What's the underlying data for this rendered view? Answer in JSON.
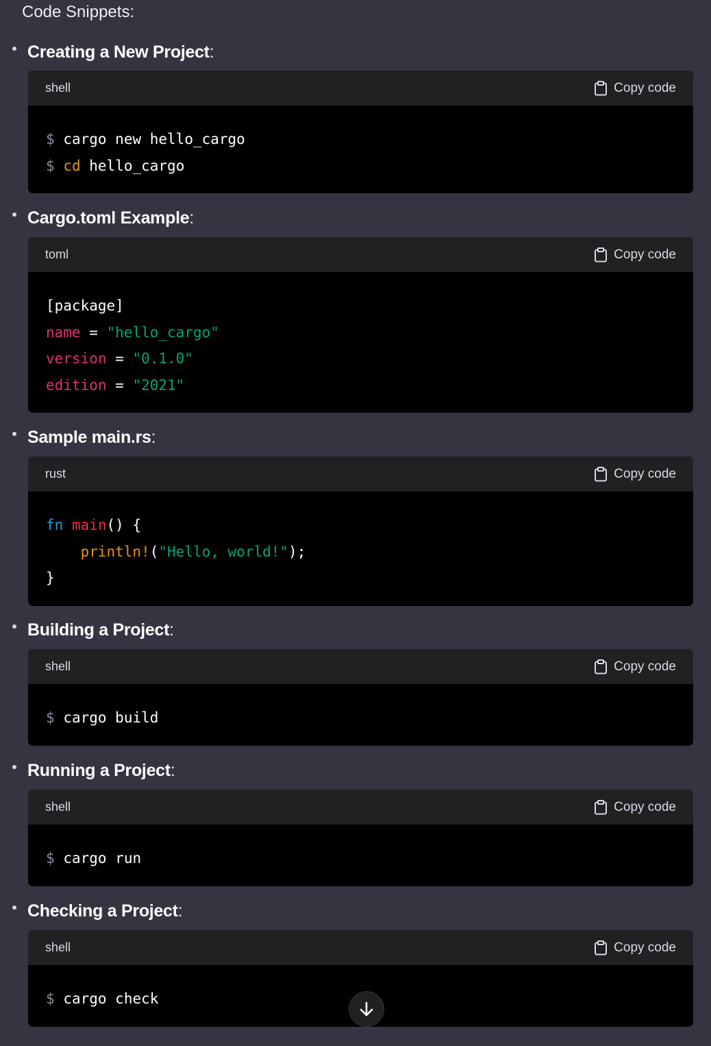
{
  "intro_text": "Code Snippets:",
  "copy_label": "Copy code",
  "sections": [
    {
      "title": "Creating a New Project",
      "colon": ":",
      "language": "shell",
      "lines": [
        {
          "prompt": "$",
          "cmd": "cargo new hello_cargo"
        },
        {
          "prompt": "$",
          "builtin": "cd",
          "rest": "hello_cargo"
        }
      ]
    },
    {
      "title": "Cargo.toml Example",
      "colon": ":",
      "language": "toml",
      "lines": [
        {
          "text": "[package]"
        },
        {
          "key": "name",
          "eq": " = ",
          "str": "\"hello_cargo\""
        },
        {
          "key": "version",
          "eq": " = ",
          "str": "\"0.1.0\""
        },
        {
          "key": "edition",
          "eq": " = ",
          "str": "\"2021\""
        }
      ]
    },
    {
      "title": "Sample main.rs",
      "colon": ":",
      "language": "rust",
      "lines": [
        {
          "kw": "fn",
          "fn": "main",
          "rest": "() {"
        },
        {
          "indent": "    ",
          "macro": "println!",
          "open": "(",
          "str": "\"Hello, world!\"",
          "close": ");"
        },
        {
          "text": "}"
        }
      ]
    },
    {
      "title": "Building a Project",
      "colon": ":",
      "language": "shell",
      "lines": [
        {
          "prompt": "$",
          "cmd": "cargo build"
        }
      ]
    },
    {
      "title": "Running a Project",
      "colon": ":",
      "language": "shell",
      "lines": [
        {
          "prompt": "$",
          "cmd": "cargo run"
        }
      ]
    },
    {
      "title": "Checking a Project",
      "colon": ":",
      "language": "shell",
      "lines": [
        {
          "prompt": "$",
          "cmd": "cargo check"
        }
      ]
    }
  ],
  "icons": {
    "copy": "clipboard-icon",
    "scroll": "arrow-down-icon"
  },
  "colors": {
    "background": "#343541",
    "code_background": "#000000",
    "code_header": "#202123",
    "toml_key": "#df3079",
    "string": "#00a67d",
    "keyword": "#2e95d3",
    "function": "#f22c3d",
    "macro_builtin": "#e9950c"
  }
}
